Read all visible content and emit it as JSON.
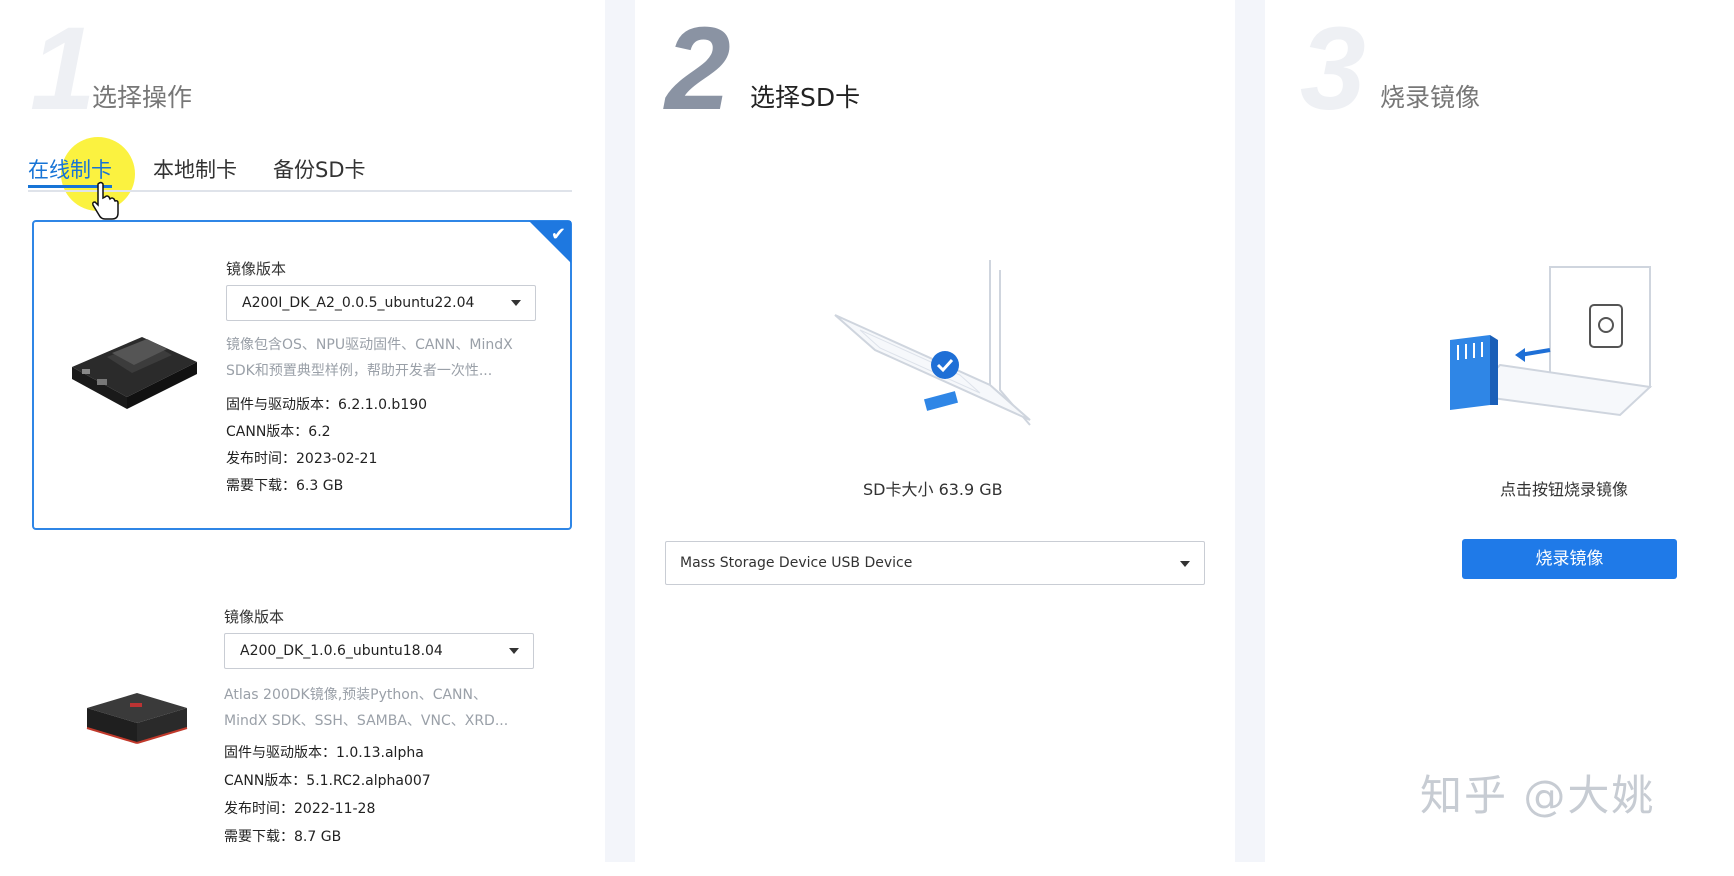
{
  "steps": [
    {
      "number": "1",
      "title": "选择操作"
    },
    {
      "number": "2",
      "title": "选择SD卡"
    },
    {
      "number": "3",
      "title": "烧录镜像"
    }
  ],
  "tabs": [
    "在线制卡",
    "本地制卡",
    "备份SD卡"
  ],
  "cards": [
    {
      "label": "镜像版本",
      "version": "A200I_DK_A2_0.0.5_ubuntu22.04",
      "desc_line1": "镜像包含OS、NPU驱动固件、CANN、MindX",
      "desc_line2": "SDK和预置典型样例，帮助开发者一次性...",
      "firmware": "固件与驱动版本：6.2.1.0.b190",
      "cann": "CANN版本：6.2",
      "release": "发布时间：2023-02-21",
      "download": "需要下载：6.3  GB"
    },
    {
      "label": "镜像版本",
      "version": "A200_DK_1.0.6_ubuntu18.04",
      "desc_line1": "Atlas 200DK镜像,预装Python、CANN、",
      "desc_line2": "MindX SDK、SSH、SAMBA、VNC、XRD...",
      "firmware": "固件与驱动版本：1.0.13.alpha",
      "cann": "CANN版本：5.1.RC2.alpha007",
      "release": "发布时间：2022-11-28",
      "download": "需要下载：8.7  GB"
    }
  ],
  "sd": {
    "size_text": "SD卡大小  63.9  GB",
    "device": "Mass Storage Device USB Device"
  },
  "burn": {
    "hint": "点击按钮烧录镜像",
    "button": "烧录镜像"
  },
  "watermark": "知乎 @大姚",
  "colors": {
    "accent": "#1f7ae8",
    "highlight": "#faf01e",
    "gutter": "#f3f5fa"
  }
}
